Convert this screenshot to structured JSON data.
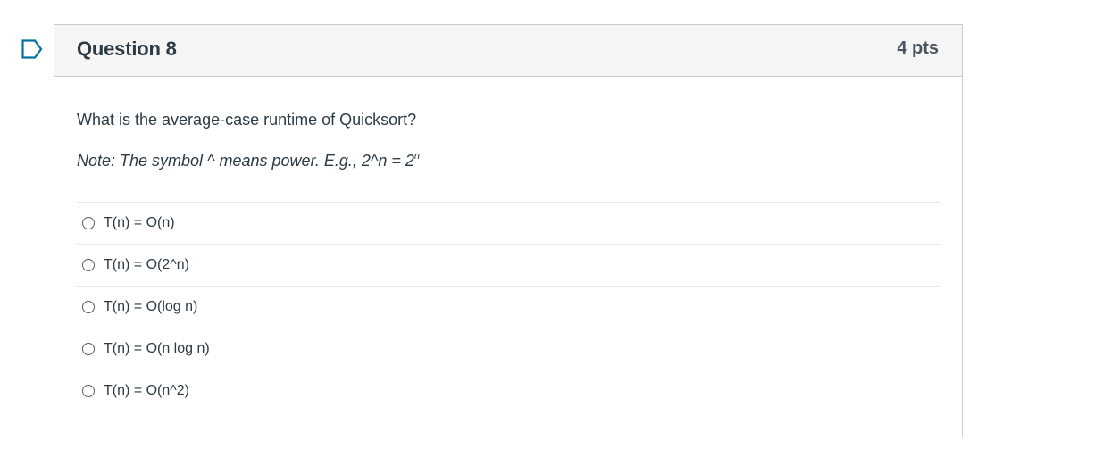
{
  "question": {
    "title": "Question 8",
    "points": "4 pts",
    "text": "What is the average-case runtime of Quicksort?",
    "note_prefix": "Note: The symbol ^ means power. E.g., 2^n = 2",
    "note_superscript": "n",
    "answers": [
      {
        "label": "T(n) = O(n)",
        "selected": false
      },
      {
        "label": "T(n) = O(2^n)",
        "selected": false
      },
      {
        "label": "T(n) = O(log n)",
        "selected": false
      },
      {
        "label": "T(n) = O(n log n)",
        "selected": false
      },
      {
        "label": "T(n) = O(n^2)",
        "selected": false
      }
    ]
  },
  "icons": {
    "flag": "flag-icon"
  },
  "colors": {
    "flag_accent": "#0770a3",
    "header_bg": "#f5f5f5",
    "border": "#c7cdd1",
    "text": "#2d3b45"
  }
}
